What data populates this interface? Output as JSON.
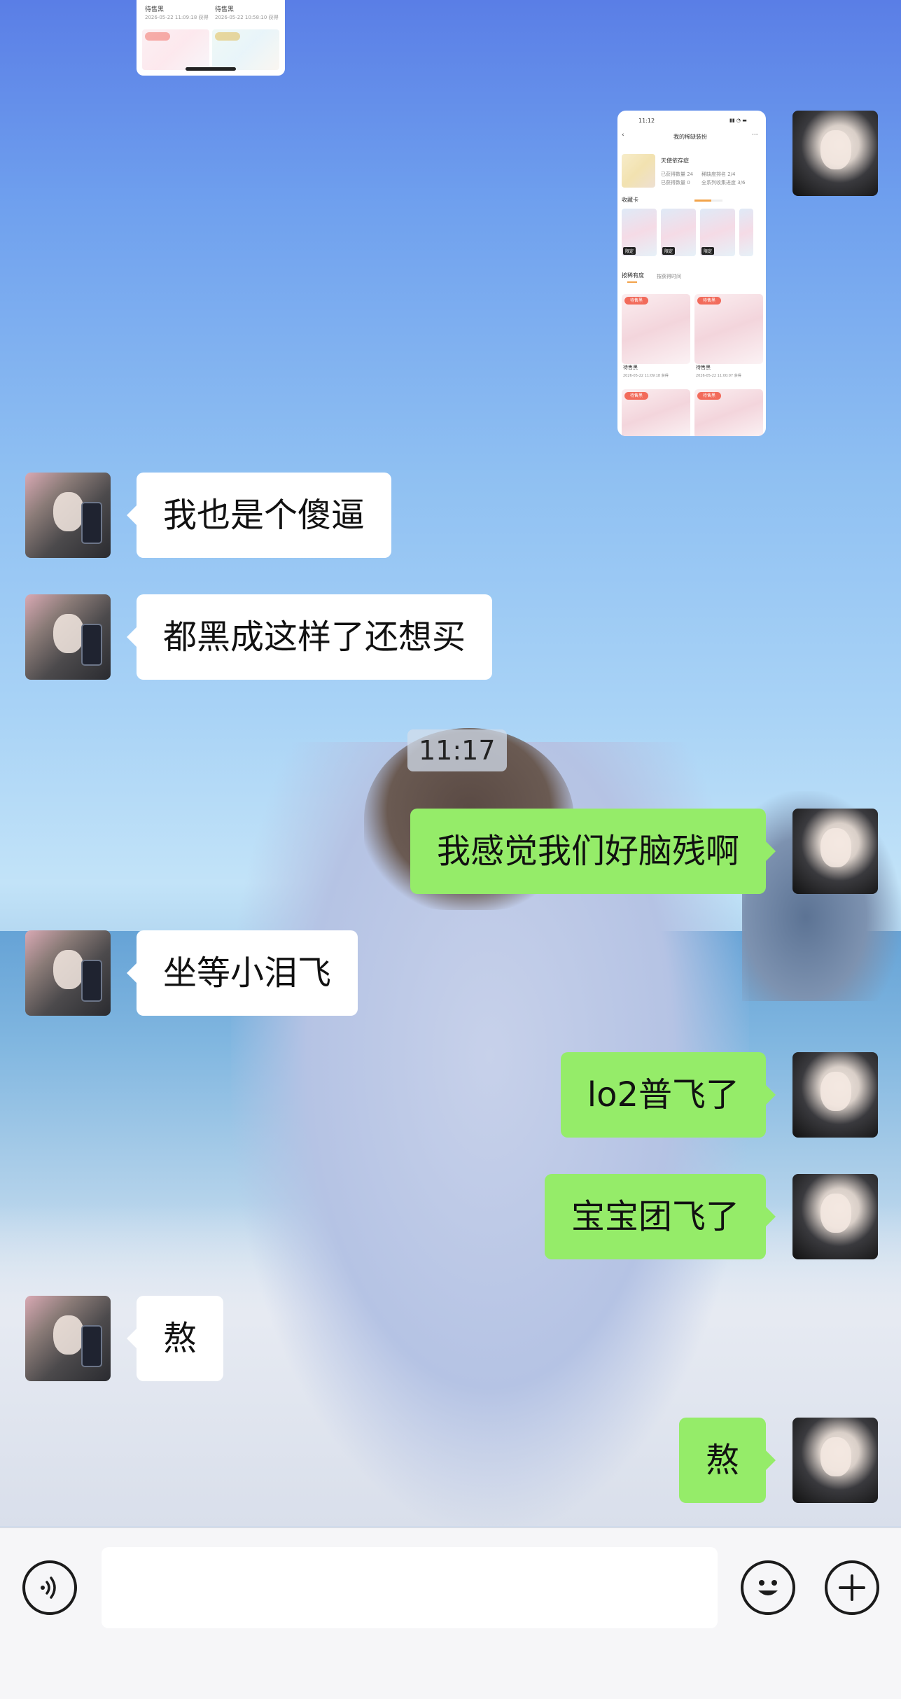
{
  "timestamp": "11:17",
  "messages": [
    {
      "side": "other",
      "text": "我也是个傻逼"
    },
    {
      "side": "other",
      "text": "都黑成这样了还想买"
    },
    {
      "side": "self",
      "text": "我感觉我们好脑残啊"
    },
    {
      "side": "other",
      "text": "坐等小泪飞"
    },
    {
      "side": "self",
      "text": "lo2普飞了"
    },
    {
      "side": "self",
      "text": "宝宝团飞了"
    },
    {
      "side": "other",
      "text": "熬"
    },
    {
      "side": "self",
      "text": "熬"
    }
  ],
  "shared_images": {
    "top_card": {
      "left_item_title": "待售黑",
      "right_item_title": "待售黑",
      "left_date": "2026-05-22 11:09:18 获得",
      "right_date": "2026-05-22 10:58:10 获得",
      "left_tag": "待售黑",
      "right_tag": "待售黑"
    },
    "phone_card": {
      "status_time": "11:12",
      "title": "我的稀缺装扮",
      "collection_name": "天使依存症",
      "stat_1": "已获得数量 24",
      "stat_2": "稀缺度排名 2/4",
      "stat_3": "已获得数量 0",
      "stat_4": "全系列收集进度 3/6",
      "section_cards": "收藏卡",
      "mini_card_label": "限定",
      "tab_1": "按稀有度",
      "tab_2": "按获得时间",
      "item_1_name": "待售黑",
      "item_2_name": "待售黑",
      "item_1_date": "2026-05-22 11:09:18 获得",
      "item_2_date": "2026-05-22 11:00:07 获得",
      "item_tag": "待售黑"
    }
  },
  "input_bar": {
    "voice_icon": "voice-icon",
    "emoji_icon": "emoji-icon",
    "plus_icon": "plus-icon",
    "text_value": "",
    "placeholder": ""
  },
  "colors": {
    "self_bubble": "#95ec69",
    "other_bubble": "#ffffff"
  }
}
